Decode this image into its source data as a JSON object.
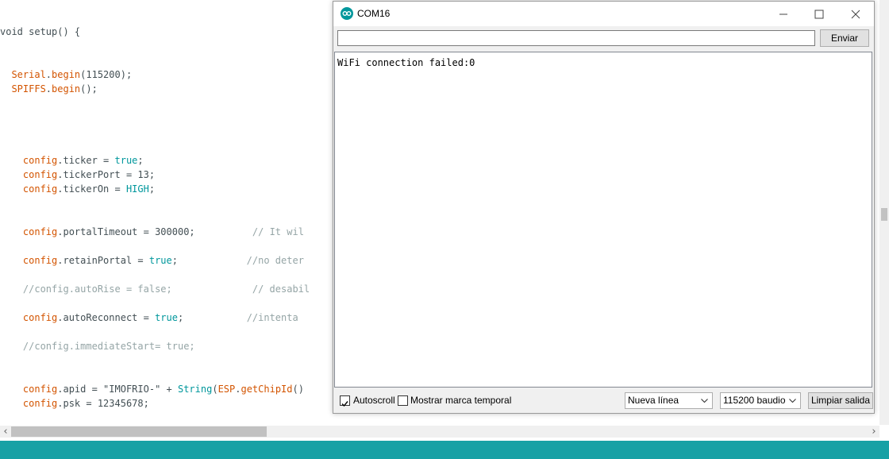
{
  "editor": {
    "lines": [
      [
        {
          "t": "void setup() {",
          "c": "pl"
        }
      ],
      [
        {
          "t": "  Serial",
          "c": "fn"
        },
        {
          "t": ".",
          "c": "pl"
        },
        {
          "t": "begin",
          "c": "fn"
        },
        {
          "t": "(115200);",
          "c": "pl"
        }
      ],
      [
        {
          "t": "  SPIFFS",
          "c": "fn"
        },
        {
          "t": ".",
          "c": "pl"
        },
        {
          "t": "begin",
          "c": "fn"
        },
        {
          "t": "();",
          "c": "pl"
        }
      ],
      [
        {
          "t": "    config",
          "c": "fn"
        },
        {
          "t": ".ticker = ",
          "c": "pl"
        },
        {
          "t": "true",
          "c": "kw"
        },
        {
          "t": ";",
          "c": "pl"
        }
      ],
      [
        {
          "t": "    config",
          "c": "fn"
        },
        {
          "t": ".tickerPort = 13;",
          "c": "pl"
        }
      ],
      [
        {
          "t": "    config",
          "c": "fn"
        },
        {
          "t": ".tickerOn = ",
          "c": "pl"
        },
        {
          "t": "HIGH",
          "c": "kw"
        },
        {
          "t": ";",
          "c": "pl"
        }
      ],
      [
        {
          "t": "    config",
          "c": "fn"
        },
        {
          "t": ".portalTimeout = 300000;          ",
          "c": "pl"
        },
        {
          "t": "// It wil",
          "c": "cm"
        }
      ],
      [
        {
          "t": "    config",
          "c": "fn"
        },
        {
          "t": ".retainPortal = ",
          "c": "pl"
        },
        {
          "t": "true",
          "c": "kw"
        },
        {
          "t": ";            ",
          "c": "pl"
        },
        {
          "t": "//no deter",
          "c": "cm"
        }
      ],
      [
        {
          "t": "    //config.autoRise = false;              // desabil",
          "c": "cm"
        }
      ],
      [
        {
          "t": "    config",
          "c": "fn"
        },
        {
          "t": ".autoReconnect = ",
          "c": "pl"
        },
        {
          "t": "true",
          "c": "kw"
        },
        {
          "t": ";           ",
          "c": "pl"
        },
        {
          "t": "//intenta",
          "c": "cm"
        }
      ],
      [
        {
          "t": "    //config.immediateStart= true;",
          "c": "cm"
        }
      ],
      [
        {
          "t": "    config",
          "c": "fn"
        },
        {
          "t": ".apid = \"IMOFRIO-\" + ",
          "c": "pl"
        },
        {
          "t": "String",
          "c": "kw"
        },
        {
          "t": "(",
          "c": "pl"
        },
        {
          "t": "ESP",
          "c": "fn"
        },
        {
          "t": ".",
          "c": "pl"
        },
        {
          "t": "getChipId",
          "c": "fn"
        },
        {
          "t": "()",
          "c": "pl"
        }
      ],
      [
        {
          "t": "    config",
          "c": "fn"
        },
        {
          "t": ".psk = 12345678;",
          "c": "pl"
        }
      ]
    ]
  },
  "serial_monitor": {
    "title": "COM16",
    "send_input_value": "",
    "send_button": "Enviar",
    "output": "WiFi connection failed:0",
    "autoscroll_label": "Autoscroll",
    "autoscroll_checked": true,
    "timestamp_label": "Mostrar marca temporal",
    "timestamp_checked": false,
    "line_ending": "Nueva línea",
    "baud_rate": "115200 baudio",
    "clear_button": "Limpiar salida"
  },
  "colors": {
    "keyword": "#00979c",
    "function": "#d35400",
    "comment": "#95a5a6",
    "status_bar": "#17a1a5"
  },
  "icons": {
    "app": "arduino-logo-icon",
    "minimize": "minimize-icon",
    "maximize": "maximize-icon",
    "close": "close-icon"
  }
}
